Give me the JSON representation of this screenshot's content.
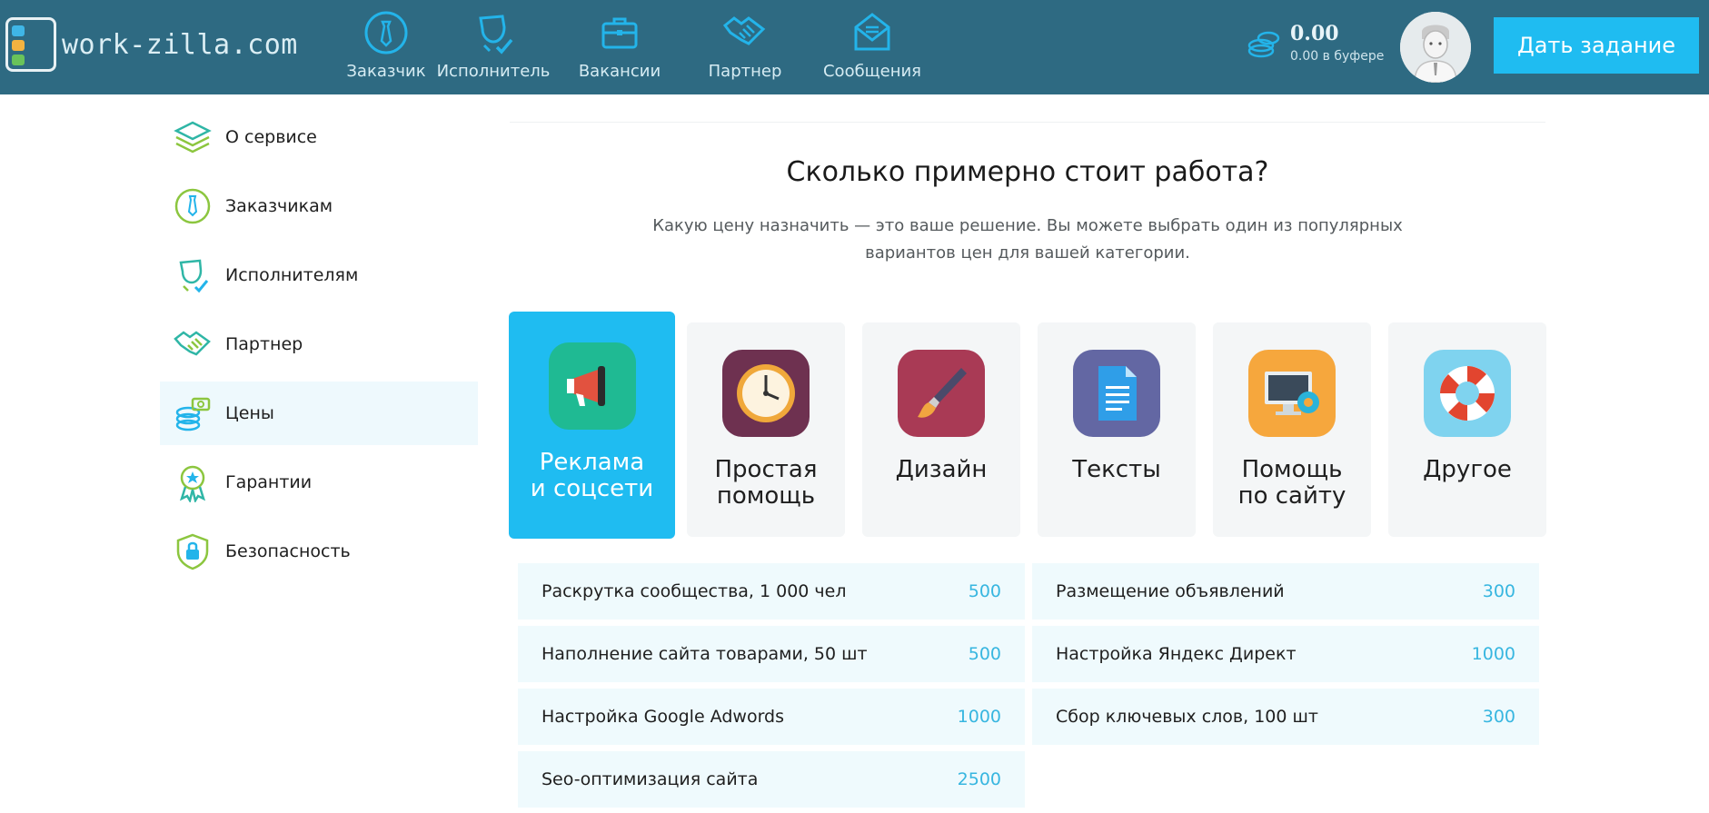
{
  "header": {
    "logo_text": "work-zilla.com",
    "nav": [
      {
        "label": "Заказчик",
        "icon": "tie-icon"
      },
      {
        "label": "Исполнитель",
        "icon": "freelancer-icon"
      },
      {
        "label": "Вакансии",
        "icon": "briefcase-icon"
      },
      {
        "label": "Партнер",
        "icon": "handshake-icon"
      },
      {
        "label": "Сообщения",
        "icon": "envelope-icon"
      }
    ],
    "balance": {
      "amount": "0.00",
      "buffer": "0.00 в буфере"
    },
    "cta_label": "Дать задание"
  },
  "sidebar": {
    "items": [
      {
        "label": "О сервисе",
        "icon": "layers-icon"
      },
      {
        "label": "Заказчикам",
        "icon": "tie-icon"
      },
      {
        "label": "Исполнителям",
        "icon": "freelancer-icon"
      },
      {
        "label": "Партнер",
        "icon": "handshake-icon"
      },
      {
        "label": "Цены",
        "icon": "coins-icon",
        "active": true
      },
      {
        "label": "Гарантии",
        "icon": "badge-icon"
      },
      {
        "label": "Безопасность",
        "icon": "shield-lock-icon"
      }
    ]
  },
  "main": {
    "title": "Сколько примерно стоит работа?",
    "subtitle": "Какую цену назначить — это ваше решение. Вы можете выбрать один из популярных вариантов цен для вашей категории.",
    "categories": [
      {
        "label": "Реклама и соцсети",
        "icon": "megaphone-icon",
        "color": "#1fba93",
        "active": true
      },
      {
        "label": "Простая помощь",
        "icon": "clock-icon",
        "color": "#6e3150"
      },
      {
        "label": "Дизайн",
        "icon": "paintbrush-icon",
        "color": "#a93a55"
      },
      {
        "label": "Тексты",
        "icon": "document-icon",
        "color": "#6367a3"
      },
      {
        "label": "Помощь по сайту",
        "icon": "monitor-gear-icon",
        "color": "#f6a73d"
      },
      {
        "label": "Другое",
        "icon": "lifebuoy-icon",
        "color": "#7fd3ef"
      }
    ],
    "prices": [
      {
        "name": "Раскрутка сообщества, 1 000 чел",
        "value": "500"
      },
      {
        "name": "Размещение объявлений",
        "value": "300"
      },
      {
        "name": "Наполнение сайта товарами, 50 шт",
        "value": "500"
      },
      {
        "name": "Настройка Яндекс Директ",
        "value": "1000"
      },
      {
        "name": "Настройка Google Adwords",
        "value": "1000"
      },
      {
        "name": "Сбор ключевых слов, 100 шт",
        "value": "300"
      },
      {
        "name": "Seo-оптимизация сайта",
        "value": "2500"
      }
    ]
  },
  "colors": {
    "header_bg": "#2e6a82",
    "accent": "#1fbcf1",
    "price_value": "#37b6e0",
    "row_bg": "#effafd"
  }
}
